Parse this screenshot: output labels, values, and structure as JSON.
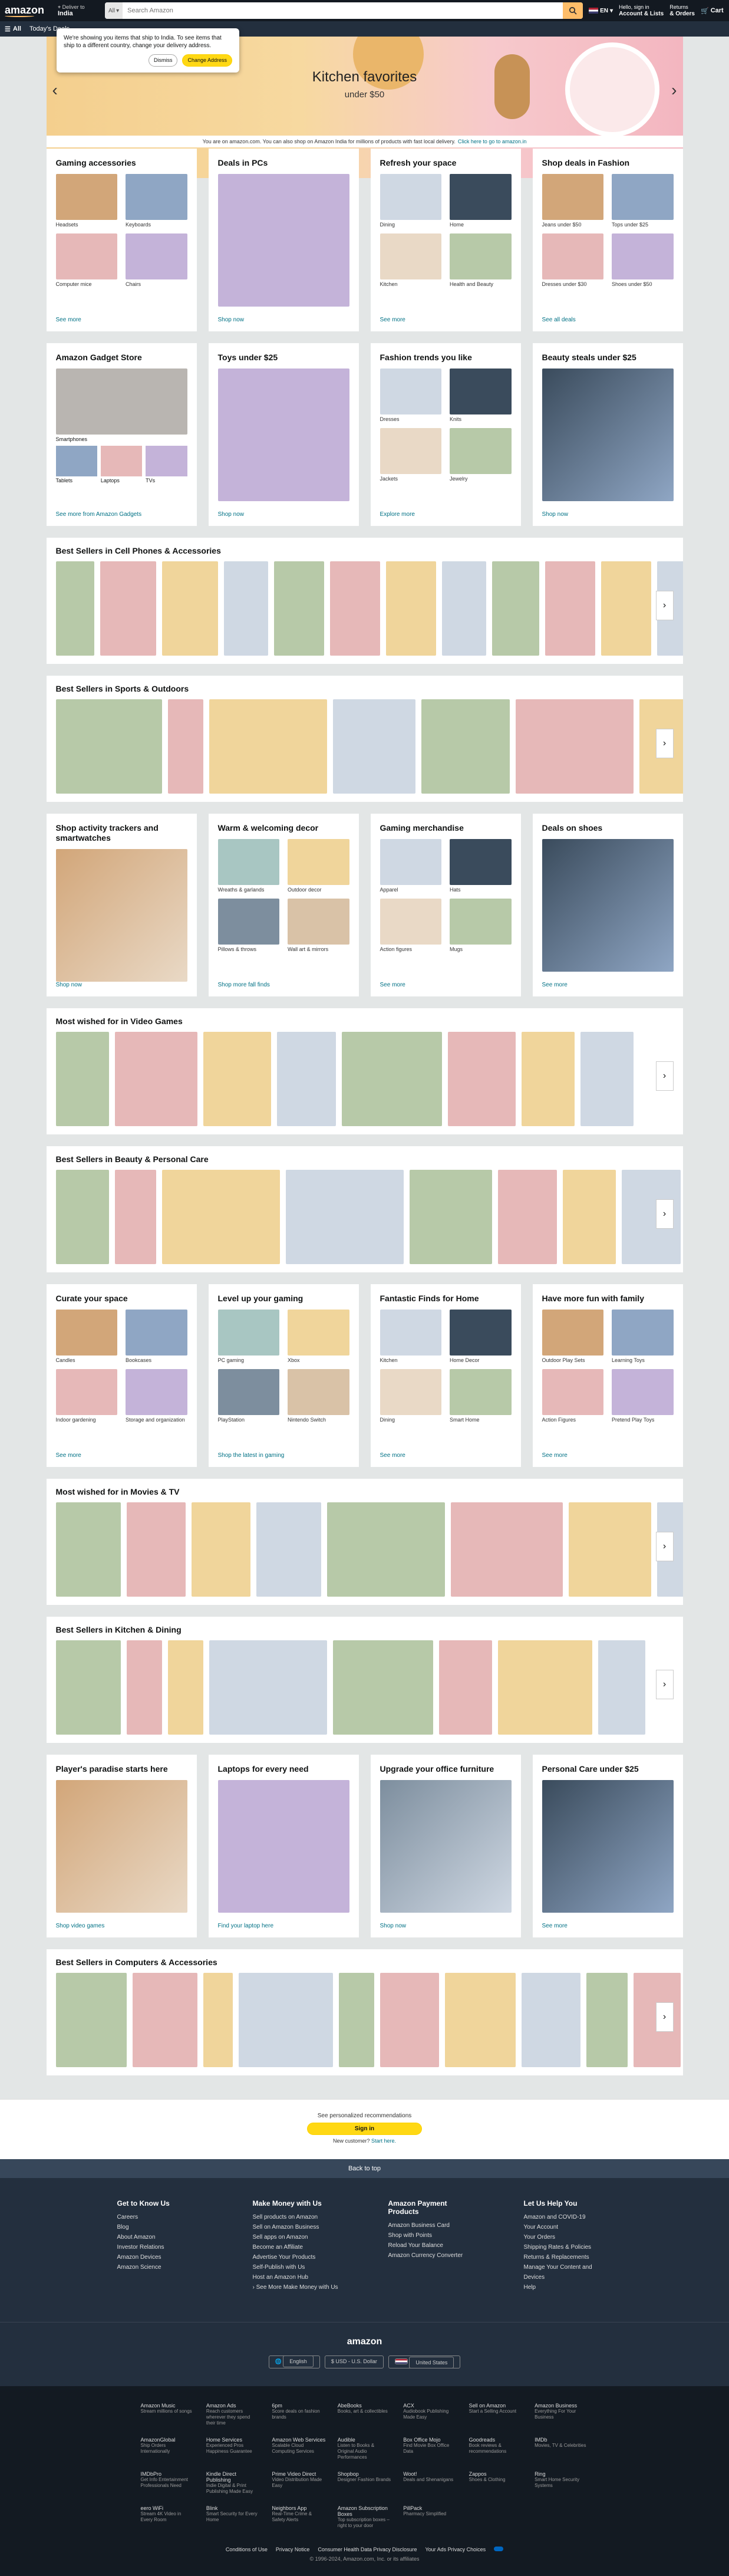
{
  "header": {
    "logo": "amazon",
    "deliver_line1": "Deliver to",
    "deliver_line2": "India",
    "search_category": "All",
    "search_placeholder": "Search Amazon",
    "language": "EN",
    "account_line1": "Hello, sign in",
    "account_line2": "Account & Lists",
    "returns_line1": "Returns",
    "returns_line2": "& Orders",
    "cart_label": "Cart"
  },
  "subnav": {
    "all": "All",
    "items": [
      "Today's Deals"
    ]
  },
  "popover": {
    "text": "We're showing you items that ship to India. To see items that ship to a different country, change your delivery address.",
    "dismiss": "Dismiss",
    "change": "Change Address"
  },
  "hero": {
    "title": "Kitchen favorites",
    "subtitle": "under $50"
  },
  "notice": {
    "text": "You are on amazon.com. You can also shop on Amazon India for millions of products with fast local delivery.",
    "link": "Click here to go to amazon.in"
  },
  "colors": {
    "nav": "#131921",
    "subnav": "#232f3e",
    "accent": "#febd69",
    "link": "#007185",
    "button": "#ffd814"
  },
  "cards_row1": [
    {
      "title": "Gaming accessories",
      "type": "quad",
      "items": [
        "Headsets",
        "Keyboards",
        "Computer mice",
        "Chairs"
      ],
      "footer": "See more"
    },
    {
      "title": "Deals in PCs",
      "type": "single",
      "footer": "Shop now"
    },
    {
      "title": "Refresh your space",
      "type": "quad",
      "items": [
        "Dining",
        "Home",
        "Kitchen",
        "Health and Beauty"
      ],
      "footer": "See more"
    },
    {
      "title": "Shop deals in Fashion",
      "type": "quad",
      "items": [
        "Jeans under $50",
        "Tops under $25",
        "Dresses under $30",
        "Shoes under $50"
      ],
      "footer": "See all deals"
    }
  ],
  "cards_row2": [
    {
      "title": "Amazon Gadget Store",
      "type": "gadget",
      "items": [
        "Smartphones",
        "Tablets",
        "Laptops",
        "TVs"
      ],
      "footer": "See more from Amazon Gadgets"
    },
    {
      "title": "Toys under $25",
      "type": "single",
      "footer": "Shop now"
    },
    {
      "title": "Fashion trends you like",
      "type": "quad",
      "items": [
        "Dresses",
        "Knits",
        "Jackets",
        "Jewelry"
      ],
      "footer": "Explore more"
    },
    {
      "title": "Beauty steals under $25",
      "type": "single",
      "footer": "Shop now"
    }
  ],
  "scroller1": {
    "title": "Best Sellers in Cell Phones & Accessories"
  },
  "scroller2": {
    "title": "Best Sellers in Sports & Outdoors"
  },
  "cards_row3": [
    {
      "title": "Shop activity trackers and smartwatches",
      "type": "single",
      "footer": "Shop now"
    },
    {
      "title": "Warm & welcoming decor",
      "type": "quad",
      "items": [
        "Wreaths & garlands",
        "Outdoor decor",
        "Pillows & throws",
        "Wall art & mirrors"
      ],
      "footer": "Shop more fall finds"
    },
    {
      "title": "Gaming merchandise",
      "type": "quad",
      "items": [
        "Apparel",
        "Hats",
        "Action figures",
        "Mugs"
      ],
      "footer": "See more"
    },
    {
      "title": "Deals on shoes",
      "type": "single",
      "footer": "See more"
    }
  ],
  "scroller3": {
    "title": "Most wished for in Video Games"
  },
  "scroller4": {
    "title": "Best Sellers in Beauty & Personal Care"
  },
  "cards_row4": [
    {
      "title": "Curate your space",
      "type": "quad",
      "items": [
        "Candles",
        "Bookcases",
        "Indoor gardening",
        "Storage and organization"
      ],
      "footer": "See more"
    },
    {
      "title": "Level up your gaming",
      "type": "quad",
      "items": [
        "PC gaming",
        "Xbox",
        "PlayStation",
        "Nintendo Switch"
      ],
      "footer": "Shop the latest in gaming"
    },
    {
      "title": "Fantastic Finds for Home",
      "type": "quad",
      "items": [
        "Kitchen",
        "Home Decor",
        "Dining",
        "Smart Home"
      ],
      "footer": "See more"
    },
    {
      "title": "Have more fun with family",
      "type": "quad",
      "items": [
        "Outdoor Play Sets",
        "Learning Toys",
        "Action Figures",
        "Pretend Play Toys"
      ],
      "footer": "See more"
    }
  ],
  "scroller5": {
    "title": "Most wished for in Movies & TV"
  },
  "scroller6": {
    "title": "Best Sellers in Kitchen & Dining"
  },
  "cards_row5": [
    {
      "title": "Player's paradise starts here",
      "type": "single",
      "footer": "Shop video games"
    },
    {
      "title": "Laptops for every need",
      "type": "single",
      "footer": "Find your laptop here"
    },
    {
      "title": "Upgrade your office furniture",
      "type": "single",
      "footer": "Shop now"
    },
    {
      "title": "Personal Care under $25",
      "type": "single",
      "footer": "See more"
    }
  ],
  "scroller7": {
    "title": "Best Sellers in Computers & Accessories"
  },
  "signin": {
    "text": "See personalized recommendations",
    "button": "Sign in",
    "new_customer": "New customer?",
    "start_here": "Start here."
  },
  "back_to_top": "Back to top",
  "footer_columns": [
    {
      "title": "Get to Know Us",
      "links": [
        "Careers",
        "Blog",
        "About Amazon",
        "Investor Relations",
        "Amazon Devices",
        "Amazon Science"
      ]
    },
    {
      "title": "Make Money with Us",
      "links": [
        "Sell products on Amazon",
        "Sell on Amazon Business",
        "Sell apps on Amazon",
        "Become an Affiliate",
        "Advertise Your Products",
        "Self-Publish with Us",
        "Host an Amazon Hub",
        "› See More Make Money with Us"
      ]
    },
    {
      "title": "Amazon Payment Products",
      "links": [
        "Amazon Business Card",
        "Shop with Points",
        "Reload Your Balance",
        "Amazon Currency Converter"
      ]
    },
    {
      "title": "Let Us Help You",
      "links": [
        "Amazon and COVID-19",
        "Your Account",
        "Your Orders",
        "Shipping Rates & Policies",
        "Returns & Replacements",
        "Manage Your Content and Devices",
        "Help"
      ]
    }
  ],
  "footer_mid": {
    "logo": "amazon",
    "language": "English",
    "currency": "$ USD - U.S. Dollar",
    "country": "United States"
  },
  "footer_services": [
    {
      "name": "Amazon Music",
      "desc": "Stream millions of songs"
    },
    {
      "name": "Amazon Ads",
      "desc": "Reach customers wherever they spend their time"
    },
    {
      "name": "6pm",
      "desc": "Score deals on fashion brands"
    },
    {
      "name": "AbeBooks",
      "desc": "Books, art & collectibles"
    },
    {
      "name": "ACX",
      "desc": "Audiobook Publishing Made Easy"
    },
    {
      "name": "Sell on Amazon",
      "desc": "Start a Selling Account"
    },
    {
      "name": "Amazon Business",
      "desc": "Everything For Your Business"
    },
    {
      "name": "AmazonGlobal",
      "desc": "Ship Orders Internationally"
    },
    {
      "name": "Home Services",
      "desc": "Experienced Pros Happiness Guarantee"
    },
    {
      "name": "Amazon Web Services",
      "desc": "Scalable Cloud Computing Services"
    },
    {
      "name": "Audible",
      "desc": "Listen to Books & Original Audio Performances"
    },
    {
      "name": "Box Office Mojo",
      "desc": "Find Movie Box Office Data"
    },
    {
      "name": "Goodreads",
      "desc": "Book reviews & recommendations"
    },
    {
      "name": "IMDb",
      "desc": "Movies, TV & Celebrities"
    },
    {
      "name": "IMDbPro",
      "desc": "Get Info Entertainment Professionals Need"
    },
    {
      "name": "Kindle Direct Publishing",
      "desc": "Indie Digital & Print Publishing Made Easy"
    },
    {
      "name": "Prime Video Direct",
      "desc": "Video Distribution Made Easy"
    },
    {
      "name": "Shopbop",
      "desc": "Designer Fashion Brands"
    },
    {
      "name": "Woot!",
      "desc": "Deals and Shenanigans"
    },
    {
      "name": "Zappos",
      "desc": "Shoes & Clothing"
    },
    {
      "name": "Ring",
      "desc": "Smart Home Security Systems"
    },
    {
      "name": "eero WiFi",
      "desc": "Stream 4K Video in Every Room"
    },
    {
      "name": "Blink",
      "desc": "Smart Security for Every Home"
    },
    {
      "name": "Neighbors App",
      "desc": "Real-Time Crime & Safety Alerts"
    },
    {
      "name": "Amazon Subscription Boxes",
      "desc": "Top subscription boxes – right to your door"
    },
    {
      "name": "PillPack",
      "desc": "Pharmacy Simplified"
    }
  ],
  "legal": {
    "links": [
      "Conditions of Use",
      "Privacy Notice",
      "Consumer Health Data Privacy Disclosure",
      "Your Ads Privacy Choices"
    ],
    "copyright": "© 1996-2024, Amazon.com, Inc. or its affiliates"
  }
}
